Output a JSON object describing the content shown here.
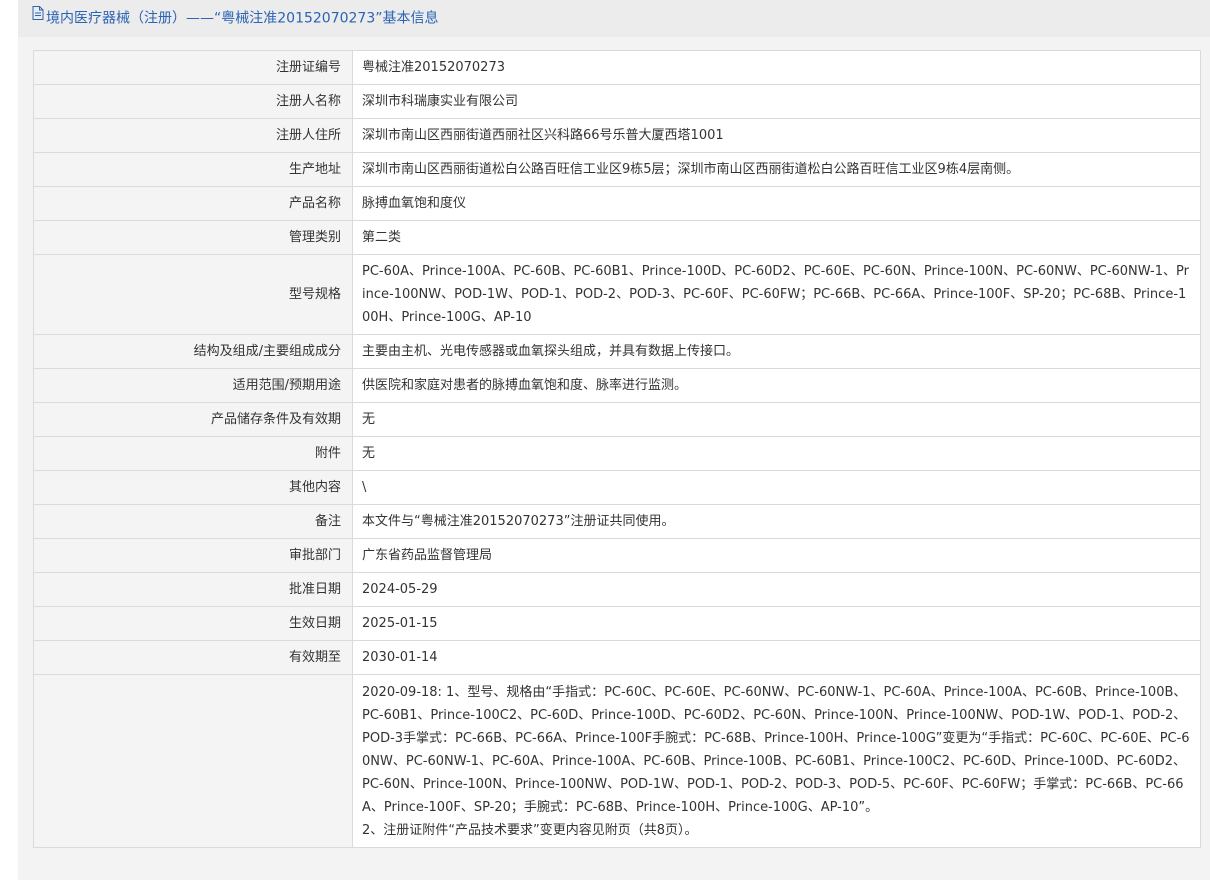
{
  "header": {
    "title": "境内医疗器械（注册）——“粤械注准20152070273”基本信息"
  },
  "rows": [
    {
      "label": "注册证编号",
      "value": "粤械注准20152070273"
    },
    {
      "label": "注册人名称",
      "value": "深圳市科瑞康实业有限公司"
    },
    {
      "label": "注册人住所",
      "value": "深圳市南山区西丽街道西丽社区兴科路66号乐普大厦西塔1001"
    },
    {
      "label": "生产地址",
      "value": "深圳市南山区西丽街道松白公路百旺信工业区9栋5层；深圳市南山区西丽街道松白公路百旺信工业区9栋4层南侧。"
    },
    {
      "label": "产品名称",
      "value": "脉搏血氧饱和度仪"
    },
    {
      "label": "管理类别",
      "value": "第二类"
    },
    {
      "label": "型号规格",
      "value": "PC-60A、Prince-100A、PC-60B、PC-60B1、Prince-100D、PC-60D2、PC-60E、PC-60N、Prince-100N、PC-60NW、PC-60NW-1、Prince-100NW、POD-1W、POD-1、POD-2、POD-3、PC-60F、PC-60FW；PC-66B、PC-66A、Prince-100F、SP-20；PC-68B、Prince-100H、Prince-100G、AP-10"
    },
    {
      "label": "结构及组成/主要组成成分",
      "value": "主要由主机、光电传感器或血氧探头组成，并具有数据上传接口。"
    },
    {
      "label": "适用范围/预期用途",
      "value": "供医院和家庭对患者的脉搏血氧饱和度、脉率进行监测。"
    },
    {
      "label": "产品储存条件及有效期",
      "value": "无"
    },
    {
      "label": "附件",
      "value": "无"
    },
    {
      "label": "其他内容",
      "value": "\\"
    },
    {
      "label": "备注",
      "value": "本文件与“粤械注准20152070273”注册证共同使用。"
    },
    {
      "label": "审批部门",
      "value": "广东省药品监督管理局"
    },
    {
      "label": "批准日期",
      "value": "2024-05-29"
    },
    {
      "label": "生效日期",
      "value": "2025-01-15"
    },
    {
      "label": "有效期至",
      "value": "2030-01-14"
    }
  ],
  "change_record": {
    "label": "",
    "value": "2020-09-18: 1、型号、规格由“手指式：PC-60C、PC-60E、PC-60NW、PC-60NW-1、PC-60A、Prince-100A、PC-60B、Prince-100B、PC-60B1、Prince-100C2、PC-60D、Prince-100D、PC-60D2、PC-60N、Prince-100N、Prince-100NW、POD-1W、POD-1、POD-2、POD-3手掌式：PC-66B、PC-66A、Prince-100F手腕式：PC-68B、Prince-100H、Prince-100G”变更为“手指式：PC-60C、PC-60E、PC-60NW、PC-60NW-1、PC-60A、Prince-100A、PC-60B、Prince-100B、PC-60B1、Prince-100C2、PC-60D、Prince-100D、PC-60D2、PC-60N、Prince-100N、Prince-100NW、POD-1W、POD-1、POD-2、POD-3、POD-5、PC-60F、PC-60FW；手掌式：PC-66B、PC-66A、Prince-100F、SP-20；手腕式：PC-68B、Prince-100H、Prince-100G、AP-10”。\n2、注册证附件“产品技术要求”变更内容见附页（共8页）。"
  },
  "colors": {
    "header_text": "#2b63b5",
    "header_bg": "#ececec",
    "label_bg": "#f4f4f4",
    "border": "#dadada",
    "text": "#333333"
  },
  "icons": {
    "header_icon": "document-icon"
  }
}
